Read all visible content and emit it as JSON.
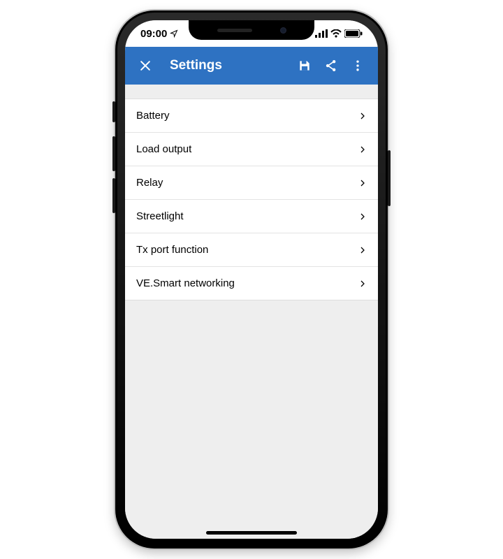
{
  "statusbar": {
    "time": "09:00"
  },
  "appbar": {
    "title": "Settings"
  },
  "settings": {
    "items": [
      {
        "label": "Battery"
      },
      {
        "label": "Load output"
      },
      {
        "label": "Relay"
      },
      {
        "label": "Streetlight"
      },
      {
        "label": "Tx port function"
      },
      {
        "label": "VE.Smart networking"
      }
    ]
  }
}
